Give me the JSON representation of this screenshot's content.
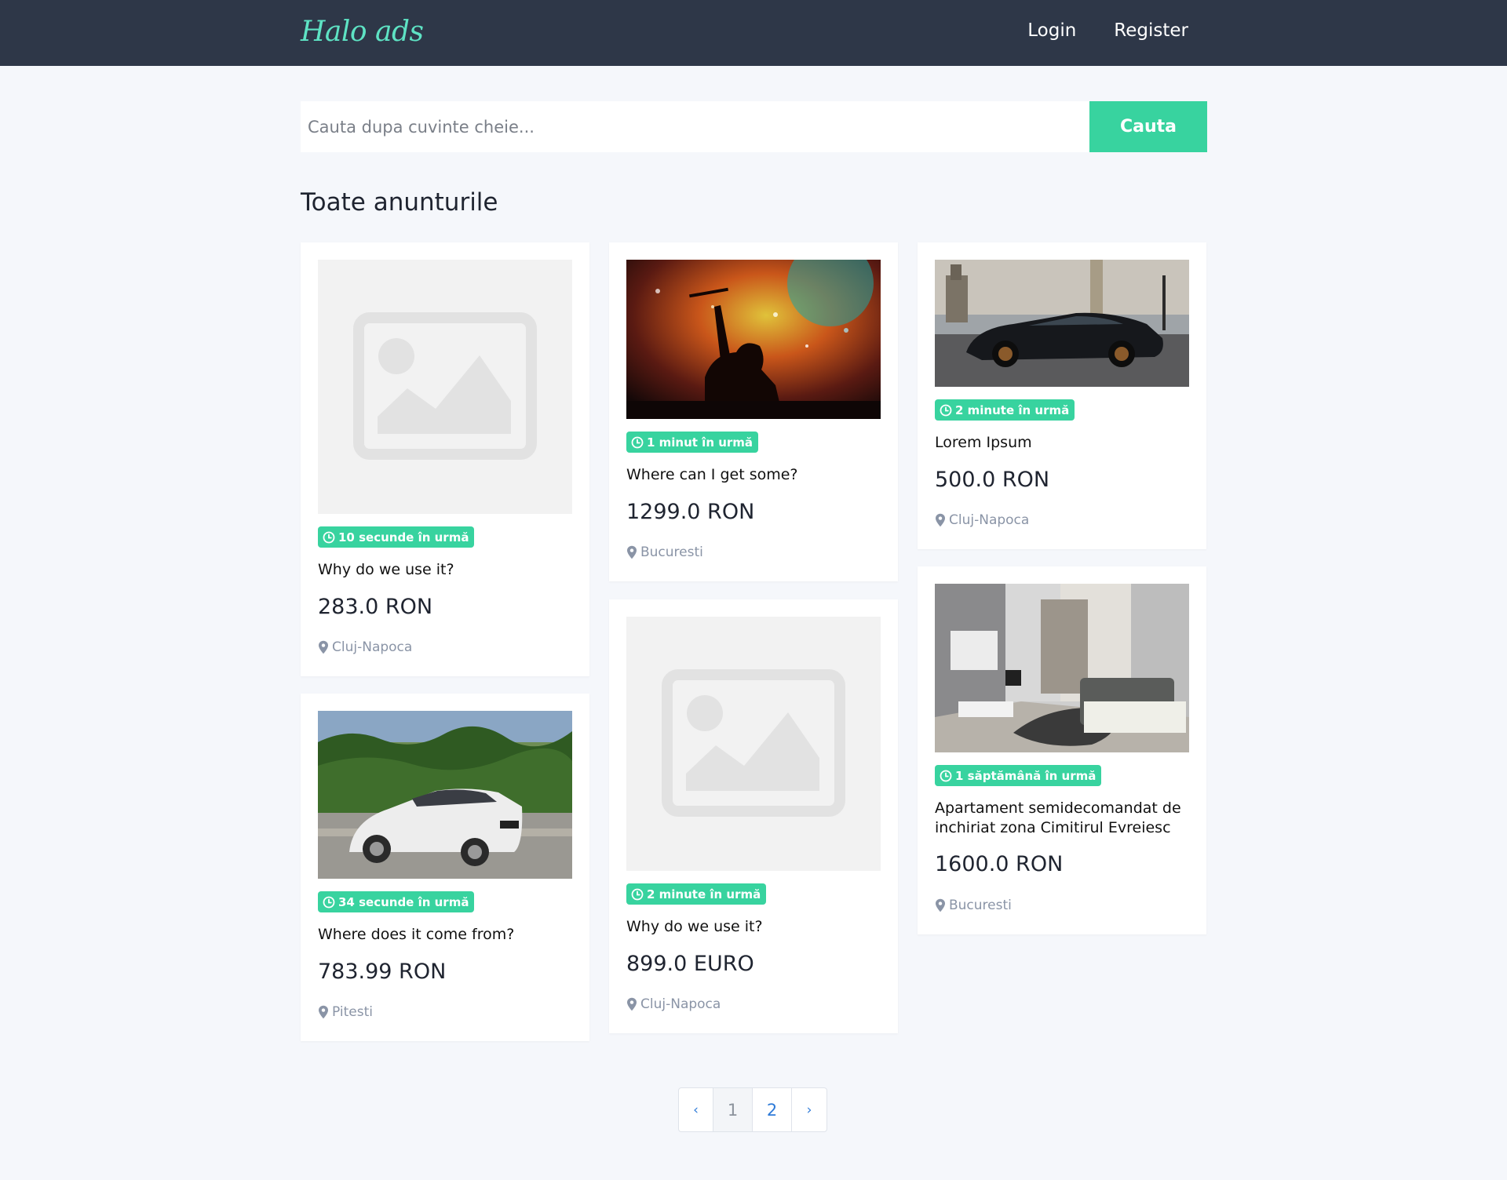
{
  "header": {
    "brand": "Halo ads",
    "nav": [
      {
        "label": "Login"
      },
      {
        "label": "Register"
      }
    ]
  },
  "search": {
    "placeholder": "Cauta dupa cuvinte cheie...",
    "button_label": "Cauta"
  },
  "section_title": "Toate anunturile",
  "listings": [
    {
      "time": "10 secunde în urmă",
      "title": "Why do we use it?",
      "price": "283.0 RON",
      "location": "Cluj-Napoca",
      "image": "placeholder-image"
    },
    {
      "time": "34 secunde în urmă",
      "title": "Where does it come from?",
      "price": "783.99 RON",
      "location": "Pitesti",
      "image": "white-car-photo"
    },
    {
      "time": "1 minut în urmă",
      "title": "Where can I get some?",
      "price": "1299.0 RON",
      "location": "Bucuresti",
      "image": "concert-drummer-photo"
    },
    {
      "time": "2 minute în urmă",
      "title": "Why do we use it?",
      "price": "899.0 EURO",
      "location": "Cluj-Napoca",
      "image": "placeholder-image"
    },
    {
      "time": "2 minute în urmă",
      "title": "Lorem Ipsum",
      "price": "500.0 RON",
      "location": "Cluj-Napoca",
      "image": "black-sports-car-photo"
    },
    {
      "time": "1 săptămână în urmă",
      "title": "Apartament semidecomandat de inchiriat zona Cimitirul Evreiesc",
      "price": "1600.0 RON",
      "location": "Bucuresti",
      "image": "living-room-photo"
    }
  ],
  "pagination": {
    "prev": "‹",
    "pages": [
      "1",
      "2"
    ],
    "current": "1",
    "next": "›"
  },
  "colors": {
    "navbar": "#2e3748",
    "brand": "#5ee3c4",
    "accent": "#38d39f",
    "background": "#f5f7fb",
    "muted": "#8a94a6"
  }
}
